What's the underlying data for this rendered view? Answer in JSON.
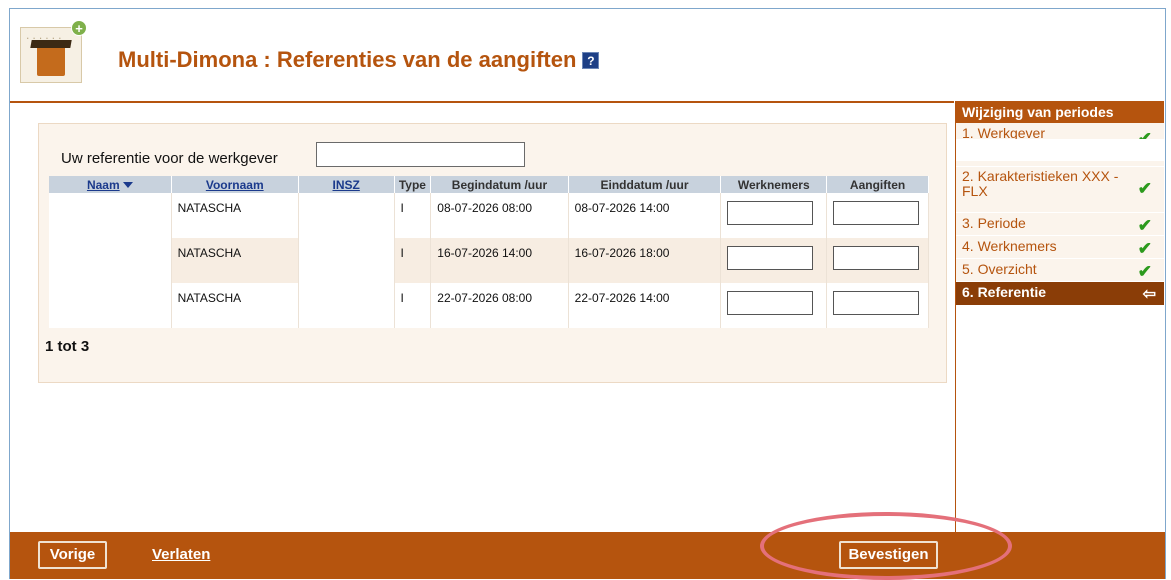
{
  "header": {
    "title": "Multi-Dimona : Referenties van de aangiften",
    "help_icon": "?"
  },
  "form": {
    "reference_label": "Uw referentie voor de werkgever",
    "reference_value": ""
  },
  "table": {
    "columns": [
      "Naam",
      "Voornaam",
      "INSZ",
      "Type",
      "Begindatum /uur",
      "Einddatum /uur",
      "Werknemers",
      "Aangiften"
    ],
    "rows": [
      {
        "naam": "",
        "voornaam": "NATASCHA",
        "insz": "",
        "type": "I",
        "begin": "08-07-2026 08:00",
        "einde": "08-07-2026 14:00"
      },
      {
        "naam": "",
        "voornaam": "NATASCHA",
        "insz": "",
        "type": "I",
        "begin": "16-07-2026 14:00",
        "einde": "16-07-2026 18:00"
      },
      {
        "naam": "",
        "voornaam": "NATASCHA",
        "insz": "",
        "type": "I",
        "begin": "22-07-2026 08:00",
        "einde": "22-07-2026 14:00"
      }
    ],
    "pager": "1 tot 3"
  },
  "sidebar": {
    "title": "Wijziging van periodes",
    "items": [
      {
        "label": "1. Werkgever",
        "status": "done"
      },
      {
        "label": "2. Karakteristieken XXX - FLX",
        "status": "done"
      },
      {
        "label": "3. Periode",
        "status": "done"
      },
      {
        "label": "4. Werknemers",
        "status": "done"
      },
      {
        "label": "5. Overzicht",
        "status": "done"
      },
      {
        "label": "6. Referentie",
        "status": "current"
      }
    ]
  },
  "footer": {
    "prev_label": "Vorige",
    "leave_label": "Verlaten",
    "confirm_label": "Bevestigen"
  },
  "colors": {
    "brand": "#b5540e",
    "active": "#8a3d07",
    "check": "#2c9a1d",
    "annotation": "#e4707a"
  }
}
